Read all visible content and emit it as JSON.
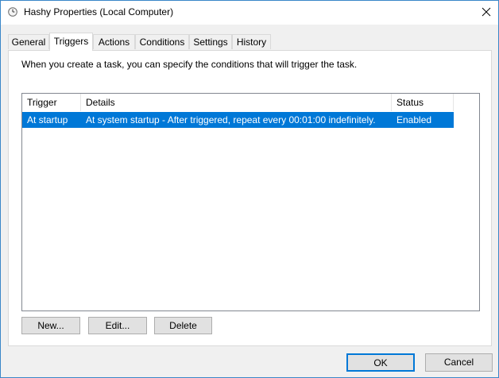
{
  "window": {
    "title": "Hashy Properties (Local Computer)"
  },
  "tabs": [
    "General",
    "Triggers",
    "Actions",
    "Conditions",
    "Settings",
    "History"
  ],
  "active_tab": "Triggers",
  "panel": {
    "description": "When you create a task, you can specify the conditions that will trigger the task."
  },
  "table": {
    "headers": [
      "Trigger",
      "Details",
      "Status"
    ],
    "rows": [
      {
        "trigger": "At startup",
        "details": "At system startup - After triggered, repeat every 00:01:00 indefinitely.",
        "status": "Enabled",
        "selected": true
      }
    ]
  },
  "buttons": {
    "new": "New...",
    "edit": "Edit...",
    "delete": "Delete",
    "ok": "OK",
    "cancel": "Cancel"
  },
  "colors": {
    "selection": "#0078d7",
    "accent_border": "#3a87c8"
  },
  "icons": {
    "title": "clock-icon",
    "close": "close-icon"
  }
}
